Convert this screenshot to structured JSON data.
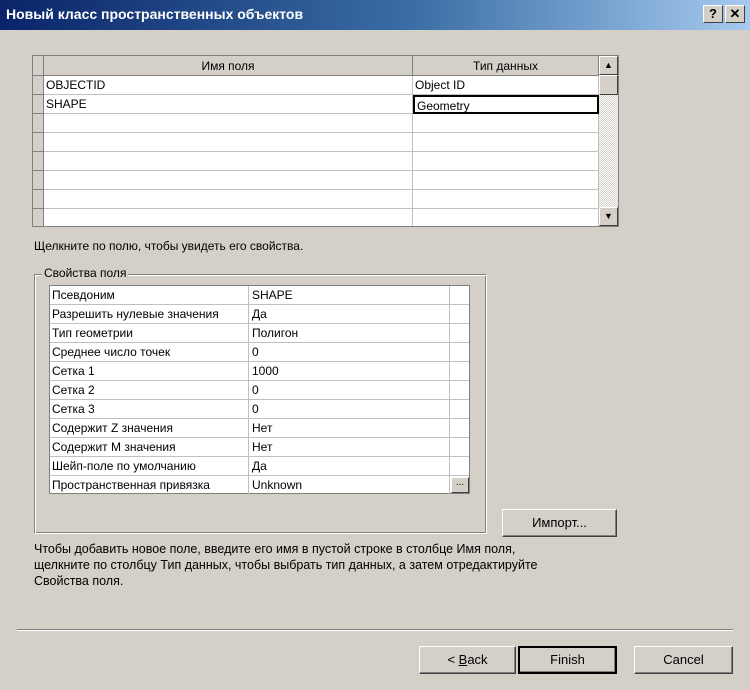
{
  "window": {
    "title": "Новый класс пространственных объектов",
    "help_button": "?",
    "close_button": "✕"
  },
  "fields_grid": {
    "headers": [
      "Имя поля",
      "Тип данных"
    ],
    "rows": [
      {
        "name": "OBJECTID",
        "type": "Object ID"
      },
      {
        "name": "SHAPE",
        "type": "Geometry"
      },
      {
        "name": "",
        "type": ""
      },
      {
        "name": "",
        "type": ""
      },
      {
        "name": "",
        "type": ""
      },
      {
        "name": "",
        "type": ""
      },
      {
        "name": "",
        "type": ""
      },
      {
        "name": "",
        "type": ""
      }
    ]
  },
  "hint": "Щелкните по полю, чтобы увидеть его свойства.",
  "properties": {
    "group_label": "Свойства поля",
    "rows": [
      {
        "name": "Псевдоним",
        "value": "SHAPE"
      },
      {
        "name": "Разрешить нулевые значения",
        "value": "Да"
      },
      {
        "name": "Тип геометрии",
        "value": "Полигон"
      },
      {
        "name": "Среднее число точек",
        "value": "0"
      },
      {
        "name": "Сетка 1",
        "value": "1000"
      },
      {
        "name": "Сетка 2",
        "value": "0"
      },
      {
        "name": "Сетка 3",
        "value": "0"
      },
      {
        "name": "Содержит Z значения",
        "value": "Нет"
      },
      {
        "name": "Содержит М значения",
        "value": "Нет"
      },
      {
        "name": "Шейп-поле по умолчанию",
        "value": "Да"
      },
      {
        "name": "Пространственная привязка",
        "value": "Unknown"
      }
    ],
    "ellipsis_label": "..."
  },
  "import_button": "Импорт...",
  "help_text": [
    "Чтобы добавить новое поле, введите его имя в пустой строке в столбце Имя поля,",
    "щелкните по столбцу Тип данных, чтобы выбрать тип данных, а затем отредактируйте",
    "Свойства поля."
  ],
  "buttons": {
    "back_prefix": "< ",
    "back_underlined": "B",
    "back_rest": "ack",
    "finish": "Finish",
    "cancel": "Cancel"
  }
}
